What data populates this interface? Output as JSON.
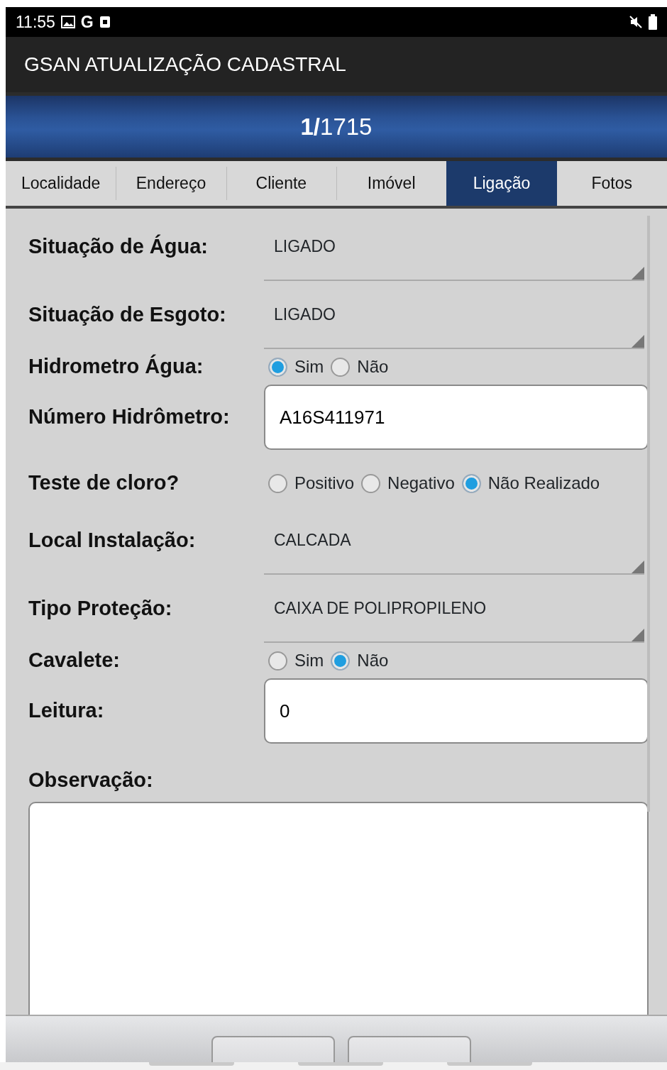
{
  "status_bar": {
    "time": "11:55",
    "glyph": "G"
  },
  "app_bar": {
    "title": "GSAN ATUALIZAÇÃO CADASTRAL"
  },
  "record_counter": {
    "text": "**1/**1715"
  },
  "tabs": [
    {
      "label": "Localidade",
      "selected": false
    },
    {
      "label": "Endereço",
      "selected": false
    },
    {
      "label": "Cliente",
      "selected": false
    },
    {
      "label": "Imóvel",
      "selected": false
    },
    {
      "label": "Ligação",
      "selected": true
    },
    {
      "label": "Fotos",
      "selected": false
    }
  ],
  "fields": [
    {
      "kind": "select",
      "label": "Situação de Água:",
      "value": "LIGADO"
    },
    {
      "kind": "select",
      "label": "Situação de Esgoto:",
      "value": "LIGADO"
    },
    {
      "kind": "radio",
      "label": "Hidrometro Água:",
      "options": [
        {
          "label": "Sim",
          "selected": true
        },
        {
          "label": "Não",
          "selected": false
        }
      ]
    },
    {
      "kind": "text",
      "label": "Número Hidrômetro:",
      "value": "A16S411971"
    },
    {
      "kind": "radio",
      "label": "Teste de cloro?",
      "options": [
        {
          "label": "Positivo",
          "selected": false
        },
        {
          "label": "Negativo",
          "selected": false
        },
        {
          "label": "Não Realizado",
          "selected": true
        }
      ]
    },
    {
      "kind": "select",
      "label": "Local Instalação:",
      "value": "CALCADA"
    },
    {
      "kind": "select",
      "label": "Tipo Proteção:",
      "value": "CAIXA DE POLIPROPILENO"
    },
    {
      "kind": "radio",
      "label": "Cavalete:",
      "options": [
        {
          "label": "Sim",
          "selected": false
        },
        {
          "label": "Não",
          "selected": true
        }
      ]
    },
    {
      "kind": "text",
      "label": "Leitura:",
      "value": "0"
    },
    {
      "kind": "textarea",
      "label": "Observação:"
    }
  ]
}
